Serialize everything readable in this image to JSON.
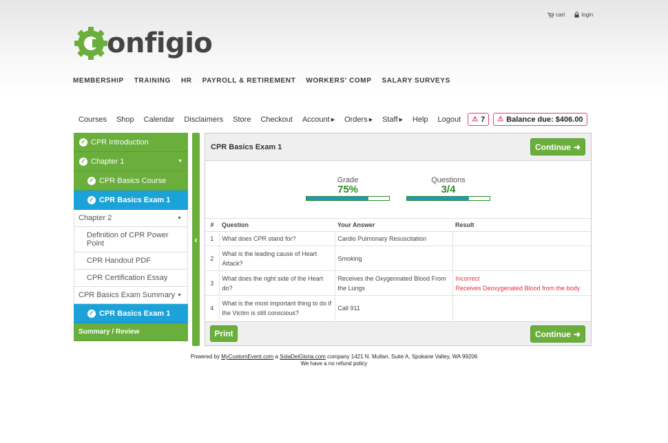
{
  "utility": {
    "cart": "cart",
    "login": "login"
  },
  "logo": {
    "text": "onfigio",
    "icon": "gear-c-logo-icon",
    "brand_color": "#6aae3c"
  },
  "main_nav": [
    "MEMBERSHIP",
    "TRAINING",
    "HR",
    "PAYROLL & RETIREMENT",
    "WORKERS' COMP",
    "SALARY SURVEYS"
  ],
  "sub_nav": {
    "courses": "Courses",
    "shop": "Shop",
    "calendar": "Calendar",
    "disclaimers": "Disclaimers",
    "store": "Store",
    "checkout": "Checkout",
    "account": "Account",
    "orders": "Orders",
    "staff": "Staff",
    "help": "Help",
    "logout": "Logout",
    "alerts_count": "7",
    "balance": "Balance due: $406.00"
  },
  "sidebar": {
    "items": [
      "CPR Introduction",
      "Chapter 1",
      "CPR Basics Course",
      "CPR Basics Exam 1",
      "Chapter 2",
      "Definition of CPR Power Point",
      "CPR Handout PDF",
      "CPR Certification Essay",
      "CPR Basics Exam Summary",
      "CPR Basics Exam 1",
      "Summary / Review"
    ]
  },
  "panel": {
    "title": "CPR Basics Exam 1",
    "continue": "Continue",
    "grade_label": "Grade",
    "grade_value": "75%",
    "grade_fraction": 0.75,
    "questions_label": "Questions",
    "questions_value": "3/4",
    "questions_fraction": 0.75,
    "columns": [
      "#",
      "Question",
      "Your Answer",
      "Result"
    ],
    "rows": [
      {
        "n": "1",
        "q": "What does CPR stand for?",
        "a": "Cardio Pulmonary Resuscitation",
        "r1": "",
        "r2": ""
      },
      {
        "n": "2",
        "q": "What is the leading cause of Heart Attack?",
        "a": "Smoking",
        "r1": "",
        "r2": ""
      },
      {
        "n": "3",
        "q": "What does the right side of the Heart do?",
        "a": "Receives the Oxygennated Blood From the Lungs",
        "r1": "Incorrect",
        "r2": "Receives Deoxygenated Blood from the body"
      },
      {
        "n": "4",
        "q": "What is the most important thing to do if the Victim is still conscious?",
        "a": "Call 911",
        "r1": "",
        "r2": ""
      }
    ],
    "print": "Print"
  },
  "footer": {
    "powered_by": "Powered by",
    "link1": "MyCustomEvent.com",
    "a": "a",
    "link2": "SolaDeiGloria.com",
    "address": "company 1421 N. Mullan, Suite A, Spokane Valley, WA 99206",
    "refund": "We have a no refund policy"
  }
}
